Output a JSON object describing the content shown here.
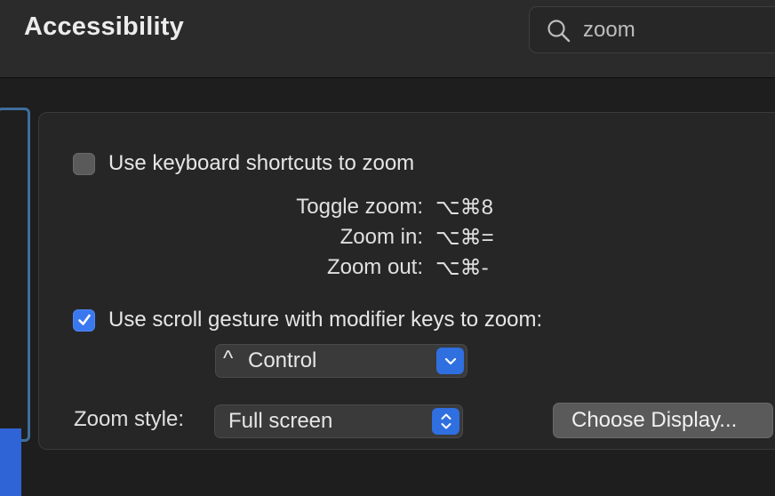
{
  "header": {
    "title": "Accessibility",
    "search": {
      "value": "zoom",
      "icon": "search-icon"
    }
  },
  "settings": {
    "keyboard_shortcuts": {
      "label": "Use keyboard shortcuts to zoom",
      "checked": false
    },
    "shortcuts": [
      {
        "label": "Toggle zoom:",
        "keys": "⌥⌘8"
      },
      {
        "label": "Zoom in:",
        "keys": "⌥⌘="
      },
      {
        "label": "Zoom out:",
        "keys": "⌥⌘-"
      }
    ],
    "scroll_gesture": {
      "label": "Use scroll gesture with modifier keys to zoom:",
      "checked": true
    },
    "modifier": {
      "caret": "^",
      "value": "Control"
    },
    "zoom_style": {
      "label": "Zoom style:",
      "value": "Full screen"
    },
    "choose_display_label": "Choose Display..."
  },
  "colors": {
    "accent": "#2f6fe0",
    "sidebar_border": "#3e6e9c",
    "background": "#1e1e1e"
  }
}
